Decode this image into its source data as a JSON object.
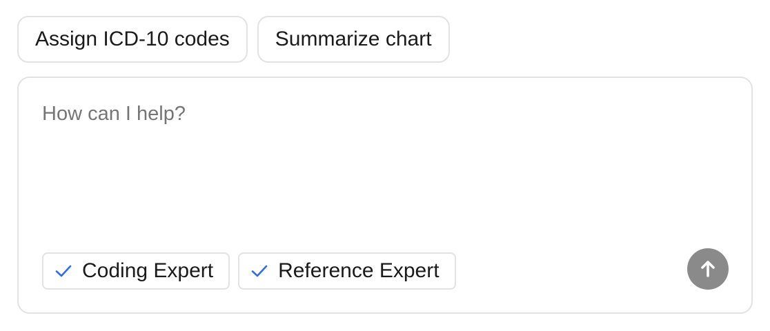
{
  "suggestions": {
    "items": [
      {
        "label": "Assign ICD-10 codes"
      },
      {
        "label": "Summarize chart"
      }
    ]
  },
  "composer": {
    "placeholder": "How can I help?",
    "value": ""
  },
  "experts": {
    "items": [
      {
        "label": "Coding Expert",
        "checked": true,
        "icon": "check-icon"
      },
      {
        "label": "Reference Expert",
        "checked": true,
        "icon": "check-icon"
      }
    ]
  },
  "send": {
    "icon": "arrow-up-icon"
  },
  "colors": {
    "check": "#2f6fdd",
    "send_bg": "#8a8a8a",
    "border": "#e2e2e2",
    "placeholder": "#757575"
  }
}
